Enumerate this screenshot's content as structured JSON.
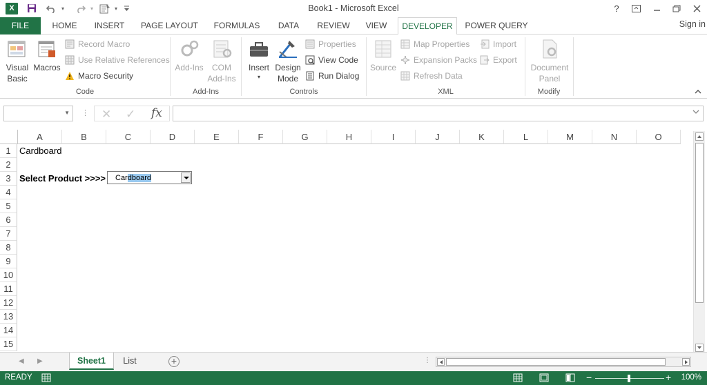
{
  "window": {
    "title": "Book1 - Microsoft Excel",
    "help": "?",
    "minimize": "—",
    "restore": "❏",
    "close": "✕"
  },
  "qat": {
    "app_icon_letter": "X",
    "save_icon": "save-icon",
    "undo_icon": "undo-icon",
    "redo_icon": "redo-icon",
    "form_icon": "form-icon",
    "customize_icon": "customize-qat-icon"
  },
  "tabs": {
    "file": "FILE",
    "items": [
      "HOME",
      "INSERT",
      "PAGE LAYOUT",
      "FORMULAS",
      "DATA",
      "REVIEW",
      "VIEW",
      "DEVELOPER",
      "POWER QUERY"
    ],
    "active": "DEVELOPER",
    "sign_in": "Sign in"
  },
  "ribbon": {
    "code": {
      "label": "Code",
      "visual_basic": [
        "Visual",
        "Basic"
      ],
      "macros": "Macros",
      "record_macro": "Record Macro",
      "use_relative": "Use Relative References",
      "macro_security": "Macro Security"
    },
    "addins": {
      "label": "Add-Ins",
      "add_ins": "Add-Ins",
      "com_addins": [
        "COM",
        "Add-Ins"
      ]
    },
    "controls": {
      "label": "Controls",
      "insert": "Insert",
      "design_mode": [
        "Design",
        "Mode"
      ],
      "properties": "Properties",
      "view_code": "View Code",
      "run_dialog": "Run Dialog"
    },
    "xml": {
      "label": "XML",
      "source": "Source",
      "map_properties": "Map Properties",
      "expansion_packs": "Expansion Packs",
      "refresh_data": "Refresh Data",
      "import": "Import",
      "export": "Export"
    },
    "modify": {
      "label": "Modify",
      "document_panel": [
        "Document",
        "Panel"
      ]
    }
  },
  "formula_bar": {
    "name_box": "",
    "fx": "fx",
    "formula": ""
  },
  "grid": {
    "columns": [
      "A",
      "B",
      "C",
      "D",
      "E",
      "F",
      "G",
      "H",
      "I",
      "J",
      "K",
      "L",
      "M",
      "N",
      "O"
    ],
    "rows": [
      "1",
      "2",
      "3",
      "4",
      "5",
      "6",
      "7",
      "8",
      "9",
      "10",
      "11",
      "12",
      "13",
      "14",
      "15"
    ],
    "cells": {
      "A1": "Cardboard",
      "A3": "Select Product >>>>"
    },
    "combo_box": {
      "text_prefix": "Car",
      "text_selected": "dboard"
    }
  },
  "sheets": {
    "tabs": [
      "Sheet1",
      "List"
    ],
    "active": "Sheet1"
  },
  "status": {
    "mode": "READY",
    "zoom": "100%",
    "zoom_level": 1.0
  },
  "colors": {
    "accent": "#217346",
    "selection": "#99c9ef"
  }
}
